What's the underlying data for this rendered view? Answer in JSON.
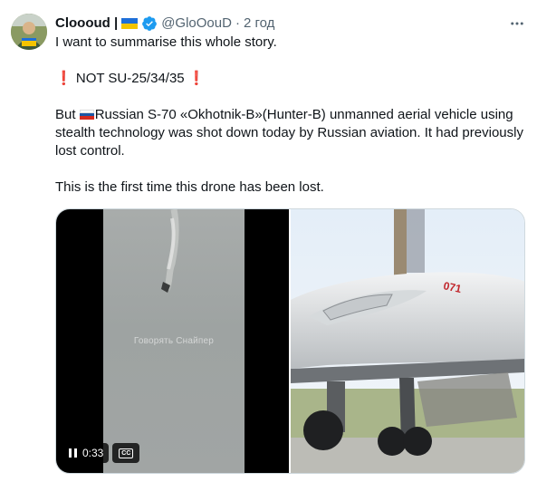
{
  "tweet": {
    "author_name": "Cloooud |",
    "handle": "@GloOouD",
    "separator": "·",
    "time": "2 год",
    "lines": {
      "intro": "I want to summarise this whole story.",
      "not_prefix": "❗",
      "not_text": " NOT SU-25/34/35 ",
      "not_suffix": "❗",
      "main_but": "But ",
      "main_text": "Russian S-70 «Okhotnik-B»(Hunter-B) unmanned aerial vehicle using stealth technology was shot down today by Russian aviation. It had previously lost control.",
      "closing": "This is the first time this drone has been lost."
    }
  },
  "media": {
    "video": {
      "watermark": "Говорять Снайпер",
      "elapsed": "0:33",
      "cc_label": "CC"
    },
    "photo": {
      "tail_marking": "071"
    }
  },
  "icons": {
    "verified": "verified-badge-icon",
    "more": "more-horizontal-icon",
    "pause": "pause-icon",
    "captions": "closed-captions-icon",
    "ua_flag": "ukraine-flag-icon",
    "ru_flag": "russia-flag-icon"
  },
  "colors": {
    "verified_blue": "#1d9bf0",
    "secondary_text": "#536471",
    "exclamation_red": "#d8232a",
    "ua_blue": "#1e6fd8",
    "ua_yellow": "#f4c400"
  }
}
